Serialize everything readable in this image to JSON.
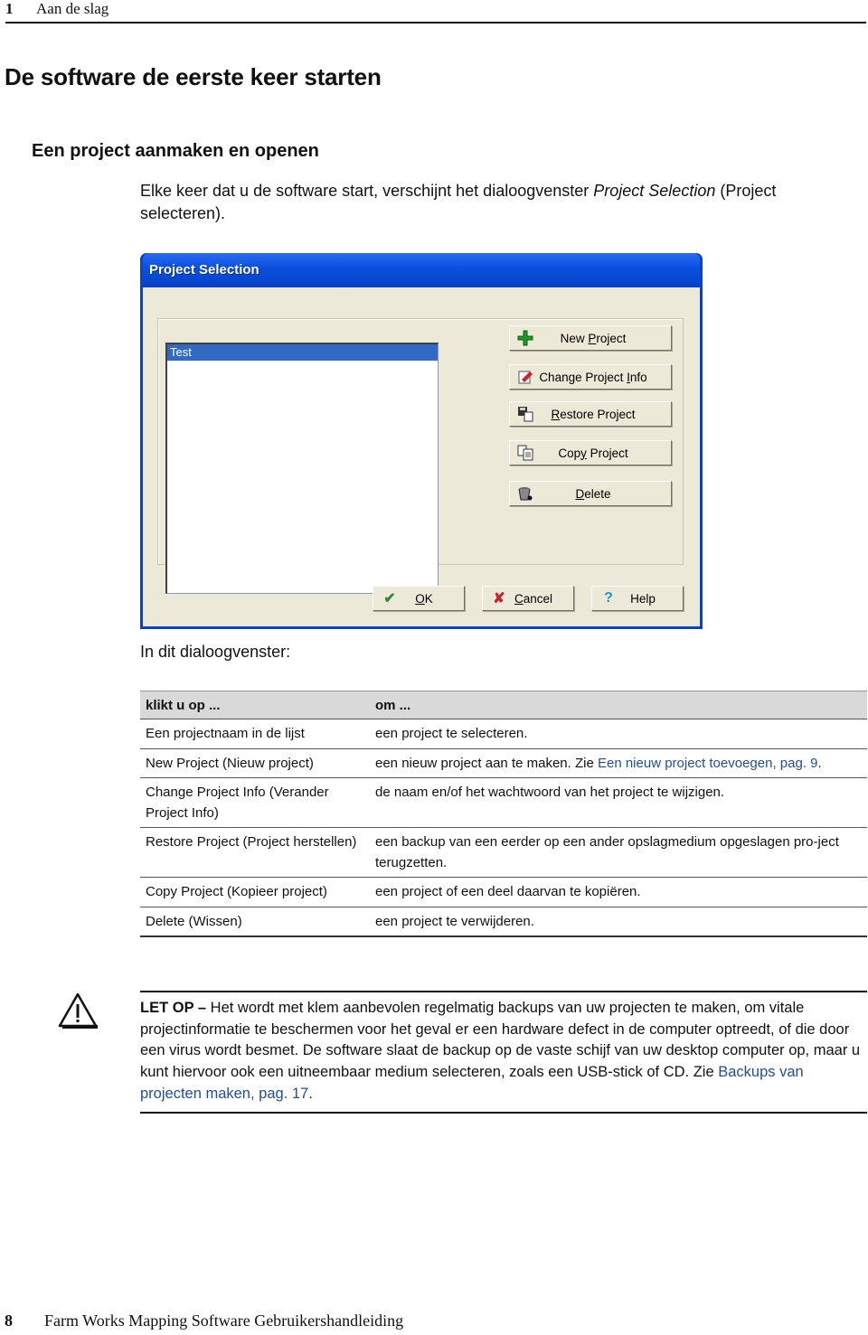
{
  "header": {
    "chapter_number": "1",
    "chapter_title": "Aan de slag"
  },
  "heading1": "De software de eerste keer starten",
  "heading2": "Een project aanmaken en openen",
  "intro": {
    "text_before": "Elke keer dat u de software start, verschijnt het dialoogvenster ",
    "emphasis": "Project Selection",
    "text_after": " (Project selecteren)."
  },
  "dialog": {
    "title": "Project Selection",
    "projects": [
      "Test"
    ],
    "selected_project": "Test",
    "side_buttons": [
      {
        "id": "new-project",
        "pre": "New ",
        "mn": "P",
        "post": "roject",
        "icon": "plus-icon"
      },
      {
        "id": "change-project-info",
        "pre": "Change Project ",
        "mn": "I",
        "post": "nfo",
        "icon": "edit-info-icon"
      },
      {
        "id": "restore-project",
        "pre": "",
        "mn": "R",
        "post": "estore Project",
        "icon": "restore-icon"
      },
      {
        "id": "copy-project",
        "pre": "Cop",
        "mn": "y",
        "post": " Project",
        "icon": "copy-icon"
      },
      {
        "id": "delete",
        "pre": "",
        "mn": "D",
        "post": "elete",
        "icon": "trash-icon"
      }
    ],
    "bottom_buttons": [
      {
        "id": "ok",
        "pre": "",
        "mn": "O",
        "post": "K",
        "icon": "check-icon",
        "glyph": "✔",
        "color": "#2e8b2e"
      },
      {
        "id": "cancel",
        "pre": "",
        "mn": "C",
        "post": "ancel",
        "icon": "x-icon",
        "glyph": "✘",
        "color": "#c0282d"
      },
      {
        "id": "help",
        "pre": "Help",
        "mn": "",
        "post": "",
        "icon": "question-icon",
        "glyph": "?",
        "color": "#1a9bd0"
      }
    ]
  },
  "intro2": "In dit dialoogvenster:",
  "table": {
    "headers": [
      "klikt u op ...",
      "om ..."
    ],
    "rows": [
      {
        "action": "Een projectnaam in de lijst",
        "purpose": "een project te selecteren.",
        "link": "",
        "link_tail": ""
      },
      {
        "action": "New Project (Nieuw project)",
        "purpose": "een nieuw project aan te maken. Zie ",
        "link": "Een nieuw project toevoegen, pag. 9",
        "link_tail": "."
      },
      {
        "action": "Change Project Info (Verander Project Info)",
        "purpose": "de naam en/of het wachtwoord van het project te wijzigen.",
        "link": "",
        "link_tail": ""
      },
      {
        "action": "Restore Project (Project herstellen)",
        "purpose": "een backup van een eerder op een ander opslagmedium opgeslagen pro-ject terugzetten.",
        "link": "",
        "link_tail": ""
      },
      {
        "action": "Copy Project (Kopieer project)",
        "purpose": "een project of een deel daarvan te kopiëren.",
        "link": "",
        "link_tail": ""
      },
      {
        "action": "Delete (Wissen)",
        "purpose": "een project te verwijderen.",
        "link": "",
        "link_tail": ""
      }
    ]
  },
  "note": {
    "label": "LET OP –",
    "text": " Het wordt met klem aanbevolen regelmatig backups van uw projecten te maken, om vitale projectinformatie te beschermen voor het geval er een hardware defect in de computer optreedt, of die door een virus wordt besmet. De software slaat de backup op de vaste schijf van uw desktop computer op, maar u kunt hiervoor ook een uitneembaar medium selecteren, zoals een USB-stick of CD. Zie ",
    "link": "Backups van projecten maken, pag. 17",
    "tail": "."
  },
  "footer": {
    "page_number": "8",
    "book_title": "Farm Works Mapping Software Gebruikershandleiding"
  },
  "colors": {
    "link": "#1f4ea0",
    "titlebar": "#0b52e0",
    "selection": "#316ac5",
    "dialog_bg": "#ece9d8"
  }
}
